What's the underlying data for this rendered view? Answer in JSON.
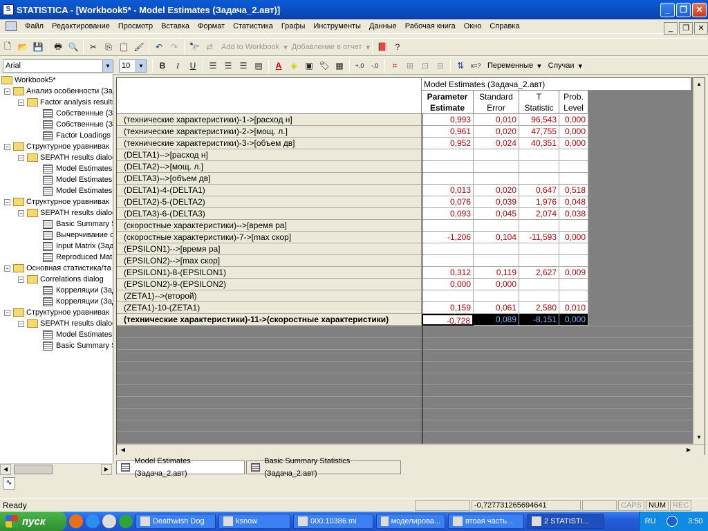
{
  "window": {
    "title": "STATISTICA - [Workbook5* - Model Estimates (Задача_2.авт)]",
    "app_icon": "statistica-icon"
  },
  "menu": [
    "Файл",
    "Редактирование",
    "Просмотр",
    "Вставка",
    "Формат",
    "Статистика",
    "Графы",
    "Инструменты",
    "Данные",
    "Рабочая книга",
    "Окно",
    "Справка"
  ],
  "toolbar1": {
    "add_workbook": "Add to Workbook",
    "add_report": "Добавление в отчет"
  },
  "toolbar2": {
    "font": "Arial",
    "size": "10",
    "vars": "Переменные",
    "cases": "Случаи"
  },
  "tree": [
    {
      "label": "Workbook5*",
      "level": 0,
      "kind": "folder",
      "exp": ""
    },
    {
      "label": "Анализ особенности (Зад",
      "level": 1,
      "kind": "folder",
      "exp": "-"
    },
    {
      "label": "Factor analysis results",
      "level": 2,
      "kind": "folder",
      "exp": "-"
    },
    {
      "label": "Собственные (За",
      "level": 3,
      "kind": "sheet"
    },
    {
      "label": "Собственные (За",
      "level": 3,
      "kind": "sheet"
    },
    {
      "label": "Factor Loadings (E",
      "level": 3,
      "kind": "sheet"
    },
    {
      "label": "Структурное уравнивак",
      "level": 1,
      "kind": "folder",
      "exp": "-"
    },
    {
      "label": "SEPATH results dialog",
      "level": 2,
      "kind": "folder",
      "exp": "-"
    },
    {
      "label": "Model Estimates (",
      "level": 3,
      "kind": "sheet"
    },
    {
      "label": "Model Estimates (",
      "level": 3,
      "kind": "sheet"
    },
    {
      "label": "Model Estimates (",
      "level": 3,
      "kind": "sheet"
    },
    {
      "label": "Структурное уравнивак",
      "level": 1,
      "kind": "folder",
      "exp": "-"
    },
    {
      "label": "SEPATH results dialog",
      "level": 2,
      "kind": "folder",
      "exp": "-"
    },
    {
      "label": "Basic Summary St",
      "level": 3,
      "kind": "sheet"
    },
    {
      "label": "Вычерчивание ст",
      "level": 3,
      "kind": "sheet"
    },
    {
      "label": "Input Matrix (Зад",
      "level": 3,
      "kind": "sheet"
    },
    {
      "label": "Reproduced Matri",
      "level": 3,
      "kind": "sheet"
    },
    {
      "label": "Основная статистика/та",
      "level": 1,
      "kind": "folder",
      "exp": "-"
    },
    {
      "label": "Correlations dialog",
      "level": 2,
      "kind": "folder",
      "exp": "-"
    },
    {
      "label": "Корреляции (Зад",
      "level": 3,
      "kind": "sheet"
    },
    {
      "label": "Корреляции (Зад",
      "level": 3,
      "kind": "sheet"
    },
    {
      "label": "Структурное уравнивак",
      "level": 1,
      "kind": "folder",
      "exp": "-"
    },
    {
      "label": "SEPATH results dialog",
      "level": 2,
      "kind": "folder",
      "exp": "-"
    },
    {
      "label": "Model Estimates (",
      "level": 3,
      "kind": "sheet"
    },
    {
      "label": "Basic Summary St",
      "level": 3,
      "kind": "sheet"
    }
  ],
  "spreadsheet": {
    "title": "Model Estimates (Задача_2.авт)",
    "columns": [
      [
        "Parameter",
        "Estimate"
      ],
      [
        "Standard",
        "Error"
      ],
      [
        "T",
        "Statistic"
      ],
      [
        "Prob.",
        "Level"
      ]
    ],
    "rows": [
      {
        "label": "(технические характеристики)-1->[расход н]",
        "v": [
          "0,993",
          "0,010",
          "96,543",
          "0,000"
        ]
      },
      {
        "label": "(технические характеристики)-2->[мощ.  л.]",
        "v": [
          "0,961",
          "0,020",
          "47,755",
          "0,000"
        ]
      },
      {
        "label": "(технические характеристики)-3->[объем дв]",
        "v": [
          "0,952",
          "0,024",
          "40,351",
          "0,000"
        ]
      },
      {
        "label": "(DELTA1)-->[расход н]",
        "v": [
          "",
          "",
          "",
          ""
        ]
      },
      {
        "label": "(DELTA2)-->[мощ.  л.]",
        "v": [
          "",
          "",
          "",
          ""
        ]
      },
      {
        "label": "(DELTA3)-->[объем дв]",
        "v": [
          "",
          "",
          "",
          ""
        ]
      },
      {
        "label": "(DELTA1)-4-(DELTA1)",
        "v": [
          "0,013",
          "0,020",
          "0,647",
          "0,518"
        ]
      },
      {
        "label": "(DELTA2)-5-(DELTA2)",
        "v": [
          "0,076",
          "0,039",
          "1,976",
          "0,048"
        ]
      },
      {
        "label": "(DELTA3)-6-(DELTA3)",
        "v": [
          "0,093",
          "0,045",
          "2,074",
          "0,038"
        ]
      },
      {
        "label": "(скоростные характеристики)-->[время ра]",
        "v": [
          "",
          "",
          "",
          ""
        ]
      },
      {
        "label": "(скоростные характеристики)-7->[max скор]",
        "v": [
          "-1,206",
          "0,104",
          "-11,593",
          "0,000"
        ]
      },
      {
        "label": "(EPSILON1)-->[время ра]",
        "v": [
          "",
          "",
          "",
          ""
        ]
      },
      {
        "label": "(EPSILON2)-->[max скор]",
        "v": [
          "",
          "",
          "",
          ""
        ]
      },
      {
        "label": "(EPSILON1)-8-(EPSILON1)",
        "v": [
          "0,312",
          "0,119",
          "2,627",
          "0,009"
        ]
      },
      {
        "label": "(EPSILON2)-9-(EPSILON2)",
        "v": [
          "0,000",
          "0,000",
          "",
          ""
        ]
      },
      {
        "label": "(ZETA1)-->(второй)",
        "v": [
          "",
          "",
          "",
          ""
        ]
      },
      {
        "label": "(ZETA1)-10-(ZETA1)",
        "v": [
          "0,159",
          "0,061",
          "2,580",
          "0,010"
        ]
      },
      {
        "label": "(технические характеристики)-11->(скоростные характеристики)",
        "v": [
          "-0,728",
          "0,089",
          "-8,151",
          "0,000"
        ],
        "bold": true,
        "selected": true
      }
    ]
  },
  "sheet_tabs": [
    "Model Estimates (Задача_2.авт)",
    "Basic Summary Statistics (Задача_2.авт)"
  ],
  "status": {
    "ready": "Ready",
    "value": "-0,727731265694641",
    "caps": "CAPS",
    "num": "NUM",
    "rec": "REC"
  },
  "taskbar": {
    "start": "пуск",
    "tasks": [
      "Deathwish Dog",
      "ksnow",
      "000.10386 mi",
      "моделирова...",
      "втоая часть...",
      "2 STATISTI..."
    ],
    "lang": "RU",
    "clock": "3:50"
  }
}
